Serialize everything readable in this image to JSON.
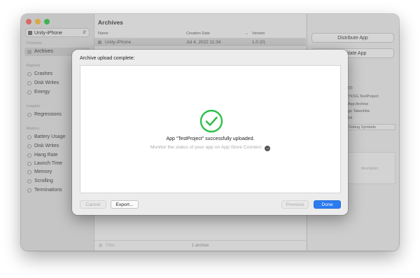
{
  "window": {
    "traffic_lights": {
      "close": "#ff5f57",
      "minimize": "#febc2e",
      "zoom": "#28c840"
    }
  },
  "sidebar": {
    "product": "Unity-iPhone",
    "sections": [
      {
        "title": "Products",
        "items": [
          {
            "label": "Archives",
            "selected": true
          }
        ]
      },
      {
        "title": "Reports",
        "items": [
          {
            "label": "Crashes"
          },
          {
            "label": "Disk Writes"
          },
          {
            "label": "Energy"
          }
        ]
      },
      {
        "title": "Insights",
        "items": [
          {
            "label": "Regressions"
          }
        ]
      },
      {
        "title": "Metrics",
        "items": [
          {
            "label": "Battery Usage"
          },
          {
            "label": "Disk Writes"
          },
          {
            "label": "Hang Rate"
          },
          {
            "label": "Launch Time"
          },
          {
            "label": "Memory"
          },
          {
            "label": "Scrolling"
          },
          {
            "label": "Terminations"
          }
        ]
      }
    ]
  },
  "main": {
    "title": "Archives",
    "columns": {
      "name": "Name",
      "creation_date": "Creation Date",
      "version": "Version"
    },
    "row": {
      "name": "Unity-iPhone",
      "date": "Jul 4, 2022 11:34",
      "version": "1.0 (0)"
    },
    "filter_placeholder": "Filter",
    "count": "1 archive"
  },
  "right_panel": {
    "distribute_label": "Distribute App",
    "validate_label": "Validate App",
    "info": [
      "(0)",
      "TKSG.TestProject",
      "App Archive",
      "go Takeshita",
      "64"
    ],
    "debug_symbols_label": "Debug Symbols",
    "description_placeholder": "description"
  },
  "sheet": {
    "title": "Archive upload complete:",
    "message": "App “TestProject” successfully uploaded.",
    "submessage": "Monitor the status of your app on App Store Connect.",
    "buttons": {
      "cancel": "Cancel",
      "export": "Export...",
      "previous": "Previous",
      "done": "Done"
    },
    "accent": "#2c7bf0",
    "success_color": "#2fbf4a"
  }
}
